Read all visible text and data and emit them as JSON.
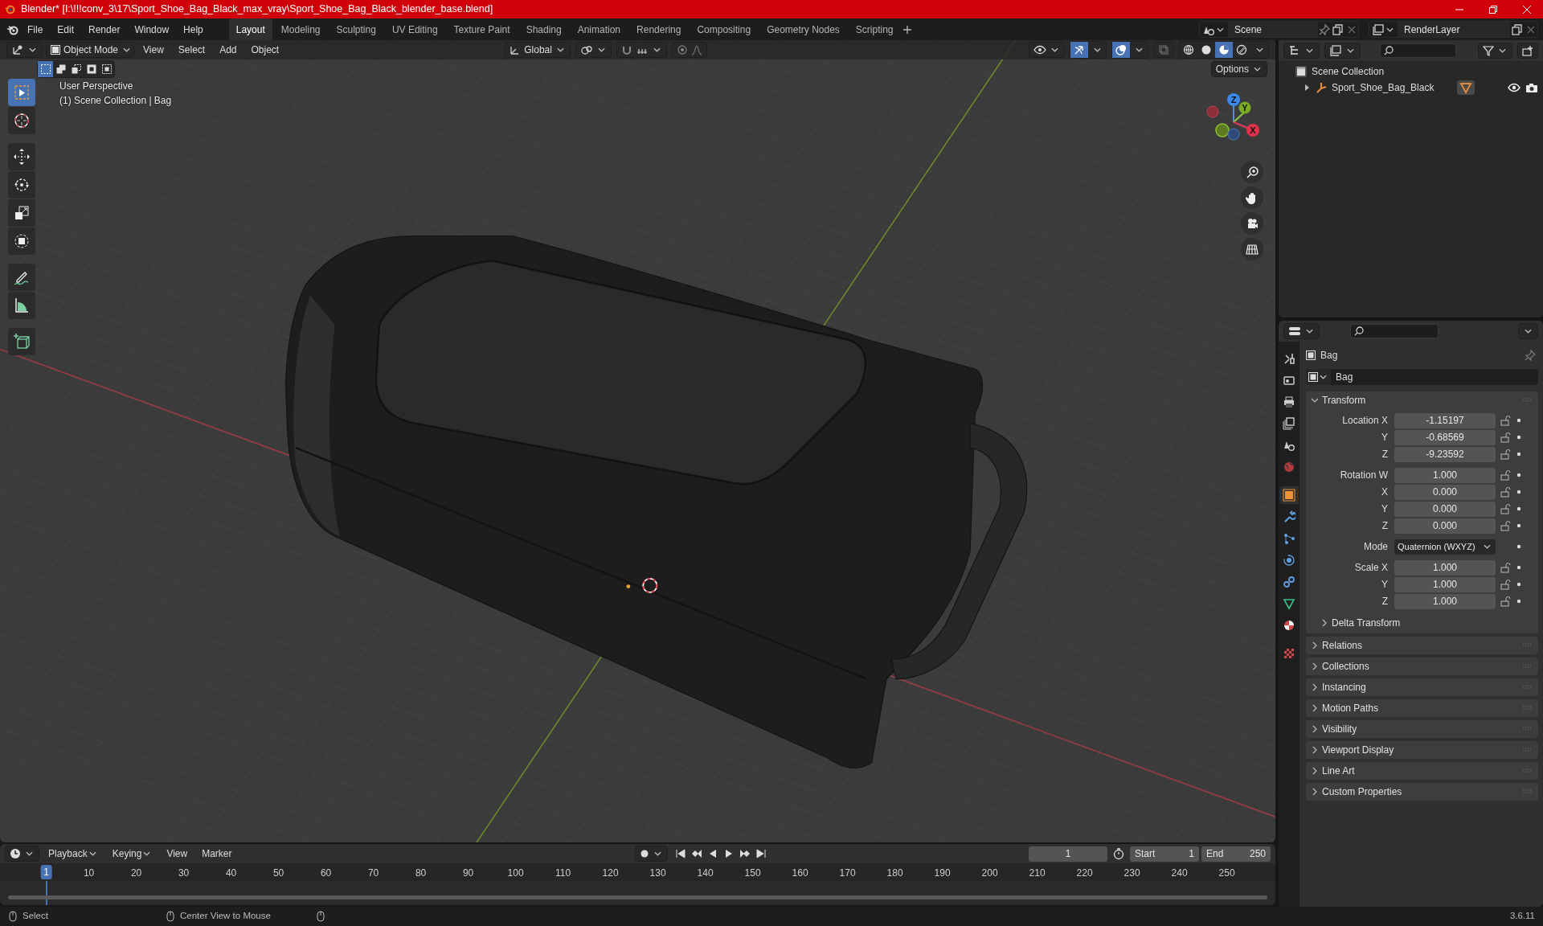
{
  "window": {
    "title": "Blender* [I:\\!!!conv_3\\17\\Sport_Shoe_Bag_Black_max_vray\\Sport_Shoe_Bag_Black_blender_base.blend]"
  },
  "menu": [
    "File",
    "Edit",
    "Render",
    "Window",
    "Help"
  ],
  "workspace_tabs": [
    {
      "label": "Layout",
      "selected": true
    },
    {
      "label": "Modeling",
      "selected": false
    },
    {
      "label": "Sculpting",
      "selected": false
    },
    {
      "label": "UV Editing",
      "selected": false
    },
    {
      "label": "Texture Paint",
      "selected": false
    },
    {
      "label": "Shading",
      "selected": false
    },
    {
      "label": "Animation",
      "selected": false
    },
    {
      "label": "Rendering",
      "selected": false
    },
    {
      "label": "Compositing",
      "selected": false
    },
    {
      "label": "Geometry Nodes",
      "selected": false
    },
    {
      "label": "Scripting",
      "selected": false
    }
  ],
  "scene": {
    "name": "Scene"
  },
  "view_layer": {
    "name": "RenderLayer"
  },
  "viewport": {
    "mode": "Object Mode",
    "menus": [
      "View",
      "Select",
      "Add",
      "Object"
    ],
    "orientation": "Global",
    "gizmos": true,
    "overlays": true,
    "shading": [
      {
        "kind": "wireframe",
        "selected": false
      },
      {
        "kind": "solid",
        "selected": false
      },
      {
        "kind": "material",
        "selected": true
      },
      {
        "kind": "rendered",
        "selected": false
      }
    ],
    "select_modes": [
      {
        "kind": "set",
        "selected": true
      },
      {
        "kind": "extend",
        "selected": false
      },
      {
        "kind": "subtract",
        "selected": false
      },
      {
        "kind": "invert",
        "selected": false
      },
      {
        "kind": "intersect",
        "selected": false
      }
    ],
    "options": "Options",
    "info": [
      "User Perspective",
      "(1) Scene Collection | Bag"
    ],
    "tools": [
      {
        "kind": "select",
        "selected": true
      },
      {
        "kind": "cursor",
        "selected": false
      },
      {
        "kind": "move",
        "selected": false
      },
      {
        "kind": "rotate",
        "selected": false
      },
      {
        "kind": "scale",
        "selected": false
      },
      {
        "kind": "transform",
        "selected": false
      },
      {
        "kind": "annotate",
        "selected": false
      },
      {
        "kind": "measure",
        "selected": false
      },
      {
        "kind": "add_cube",
        "selected": false
      }
    ],
    "gizmo_axes": [
      "Z",
      "Y",
      "X"
    ]
  },
  "outliner": {
    "items": [
      {
        "label": "Scene Collection",
        "children": [
          {
            "label": "Sport_Shoe_Bag_Black",
            "expanded": false
          }
        ]
      }
    ]
  },
  "properties": {
    "tabs": [
      {
        "kind": "tool",
        "selected": false
      },
      {
        "kind": "render",
        "selected": false
      },
      {
        "kind": "output",
        "selected": false
      },
      {
        "kind": "view_layer",
        "selected": false
      },
      {
        "kind": "scene",
        "selected": false
      },
      {
        "kind": "world",
        "selected": false
      },
      {
        "kind": "object",
        "selected": true
      },
      {
        "kind": "modifiers",
        "selected": false
      },
      {
        "kind": "particles",
        "selected": false
      },
      {
        "kind": "physics",
        "selected": false
      },
      {
        "kind": "constraints",
        "selected": false
      },
      {
        "kind": "data",
        "selected": false
      },
      {
        "kind": "material",
        "selected": false
      },
      {
        "kind": "texture",
        "selected": false
      }
    ],
    "context": "Bag",
    "object_name": "Bag",
    "panels": [
      {
        "label": "Transform",
        "expanded": true,
        "groups": [
          [
            {
              "kind": "number",
              "label": "Location X",
              "value": "-1.15197"
            },
            {
              "kind": "number",
              "label": "Y",
              "value": "-0.68569"
            },
            {
              "kind": "number",
              "label": "Z",
              "value": "-9.23592"
            }
          ],
          [
            {
              "kind": "number",
              "label": "Rotation W",
              "value": "1.000"
            },
            {
              "kind": "number",
              "label": "X",
              "value": "0.000"
            },
            {
              "kind": "number",
              "label": "Y",
              "value": "0.000"
            },
            {
              "kind": "number",
              "label": "Z",
              "value": "0.000"
            }
          ],
          [
            {
              "kind": "dropdown",
              "label": "Mode",
              "value": "Quaternion (WXYZ)"
            }
          ],
          [
            {
              "kind": "number",
              "label": "Scale X",
              "value": "1.000"
            },
            {
              "kind": "number",
              "label": "Y",
              "value": "1.000"
            },
            {
              "kind": "number",
              "label": "Z",
              "value": "1.000"
            }
          ]
        ],
        "subpanels": [
          {
            "label": "Delta Transform",
            "expanded": false
          }
        ]
      },
      {
        "label": "Relations",
        "expanded": false
      },
      {
        "label": "Collections",
        "expanded": false
      },
      {
        "label": "Instancing",
        "expanded": false
      },
      {
        "label": "Motion Paths",
        "expanded": false
      },
      {
        "label": "Visibility",
        "expanded": false
      },
      {
        "label": "Viewport Display",
        "expanded": false
      },
      {
        "label": "Line Art",
        "expanded": false
      },
      {
        "label": "Custom Properties",
        "expanded": false
      }
    ]
  },
  "timeline": {
    "menus": [
      {
        "label": "Playback",
        "kind": "dropdown"
      },
      {
        "label": "Keying",
        "kind": "dropdown"
      },
      {
        "label": "View",
        "kind": "plain"
      },
      {
        "label": "Marker",
        "kind": "plain"
      }
    ],
    "current_frame": "1",
    "start": {
      "label": "Start",
      "value": "1"
    },
    "end": {
      "label": "End",
      "value": "250"
    },
    "playhead": "1",
    "ruler": [
      "10",
      "20",
      "30",
      "40",
      "50",
      "60",
      "70",
      "80",
      "90",
      "100",
      "110",
      "120",
      "130",
      "140",
      "150",
      "160",
      "170",
      "180",
      "190",
      "200",
      "210",
      "220",
      "230",
      "240",
      "250"
    ]
  },
  "status_bar": {
    "hints": [
      "Select",
      "Center View to Mouse"
    ],
    "version": "3.6.11"
  }
}
